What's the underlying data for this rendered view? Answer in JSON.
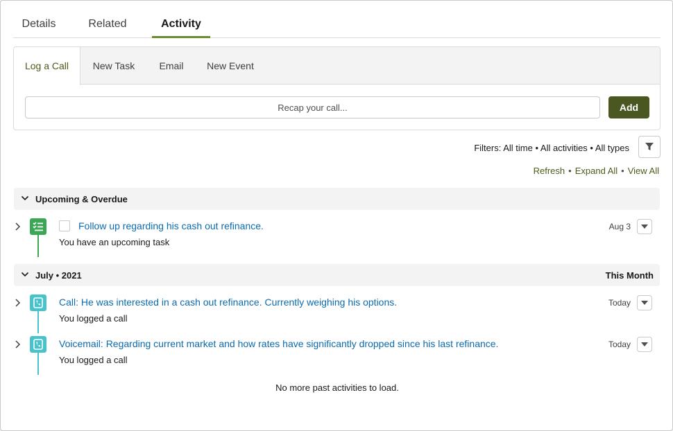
{
  "top_tabs": [
    "Details",
    "Related",
    "Activity"
  ],
  "composer": {
    "tabs": [
      "Log a Call",
      "New Task",
      "Email",
      "New Event"
    ],
    "input_placeholder": "Recap your call...",
    "add_label": "Add"
  },
  "filters": {
    "text": "Filters: All time • All activities • All types",
    "links": [
      "Refresh",
      "Expand All",
      "View All"
    ]
  },
  "sections": [
    {
      "title": "Upcoming & Overdue",
      "right": "",
      "items": [
        {
          "type": "task",
          "title": "Follow up regarding his cash out refinance.",
          "subtitle": "You have an upcoming task",
          "date": "Aug 3"
        }
      ]
    },
    {
      "title": "July • 2021",
      "right": "This Month",
      "items": [
        {
          "type": "call",
          "title": "Call: He was interested in a cash out refinance. Currently weighing his options.",
          "subtitle": "You logged a call",
          "date": "Today"
        },
        {
          "type": "call",
          "title": "Voicemail: Regarding current market and how rates have significantly dropped since his last refinance.",
          "subtitle": "You logged a call",
          "date": "Today"
        }
      ]
    }
  ],
  "footer": "No more past activities to load.",
  "colors": {
    "accent": "#6c8c2b",
    "add_button": "#4a5720",
    "link": "#0b6bad",
    "task_icon": "#3ba755",
    "call_icon": "#48c3cc"
  },
  "icons": [
    "filter-icon",
    "chevron-down-icon",
    "chevron-right-icon",
    "task-icon",
    "call-icon",
    "dropdown-icon"
  ]
}
